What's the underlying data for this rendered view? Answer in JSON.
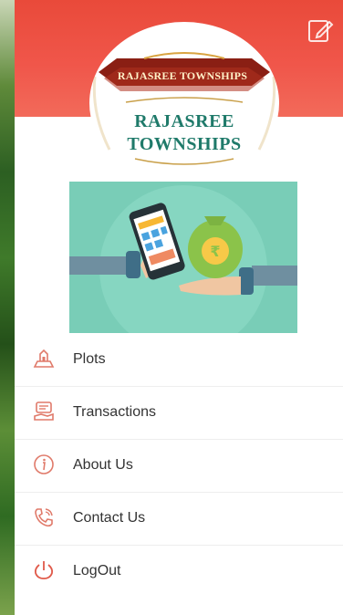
{
  "logo": {
    "banner": "RAJASREE TOWNSHIPS",
    "line1": "RAJASREE",
    "line2": "TOWNSHIPS"
  },
  "menu": [
    {
      "label": "Plots",
      "icon": "plots-icon"
    },
    {
      "label": "Transactions",
      "icon": "transactions-icon"
    },
    {
      "label": "About Us",
      "icon": "info-icon"
    },
    {
      "label": "Contact Us",
      "icon": "phone-icon"
    },
    {
      "label": "LogOut",
      "icon": "power-icon"
    }
  ],
  "colors": {
    "header": "#ee5347",
    "accent": "#e05a4a",
    "logo_text": "#1f7a6a",
    "illustration_bg": "#79cdb7"
  }
}
